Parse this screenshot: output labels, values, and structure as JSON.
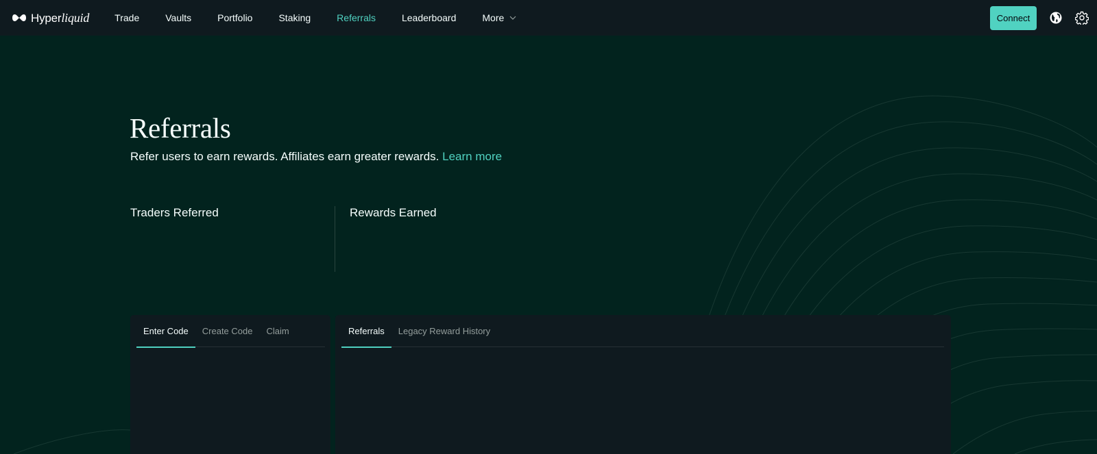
{
  "app": {
    "brand_primary": "Hyper",
    "brand_italic": "liquid"
  },
  "nav": {
    "items": [
      {
        "label": "Trade",
        "active": false
      },
      {
        "label": "Vaults",
        "active": false
      },
      {
        "label": "Portfolio",
        "active": false
      },
      {
        "label": "Staking",
        "active": false
      },
      {
        "label": "Referrals",
        "active": true
      },
      {
        "label": "Leaderboard",
        "active": false
      },
      {
        "label": "More",
        "active": false
      }
    ],
    "more_icon": "chevron-down-icon"
  },
  "toolbar": {
    "connect_label": "Connect",
    "language_icon": "globe-icon",
    "settings_icon": "gear-icon"
  },
  "header": {
    "title": "Referrals",
    "subtitle": "Refer users to earn rewards. Affiliates earn greater rewards.",
    "learn_more": "Learn more"
  },
  "stats": {
    "traders_referred_label": "Traders Referred",
    "rewards_earned_label": "Rewards Earned"
  },
  "code_panel": {
    "tabs": [
      {
        "label": "Enter Code",
        "active": true
      },
      {
        "label": "Create Code",
        "active": false
      },
      {
        "label": "Claim",
        "active": false
      }
    ]
  },
  "history_panel": {
    "tabs": [
      {
        "label": "Referrals",
        "active": true
      },
      {
        "label": "Legacy Reward History",
        "active": false
      }
    ]
  },
  "colors": {
    "accent": "#50d2c1",
    "background": "#02231e",
    "panel": "#0f1a1f",
    "topbar": "#0f1a1f",
    "muted_text": "#949e9c",
    "text": "#f6fefd"
  }
}
